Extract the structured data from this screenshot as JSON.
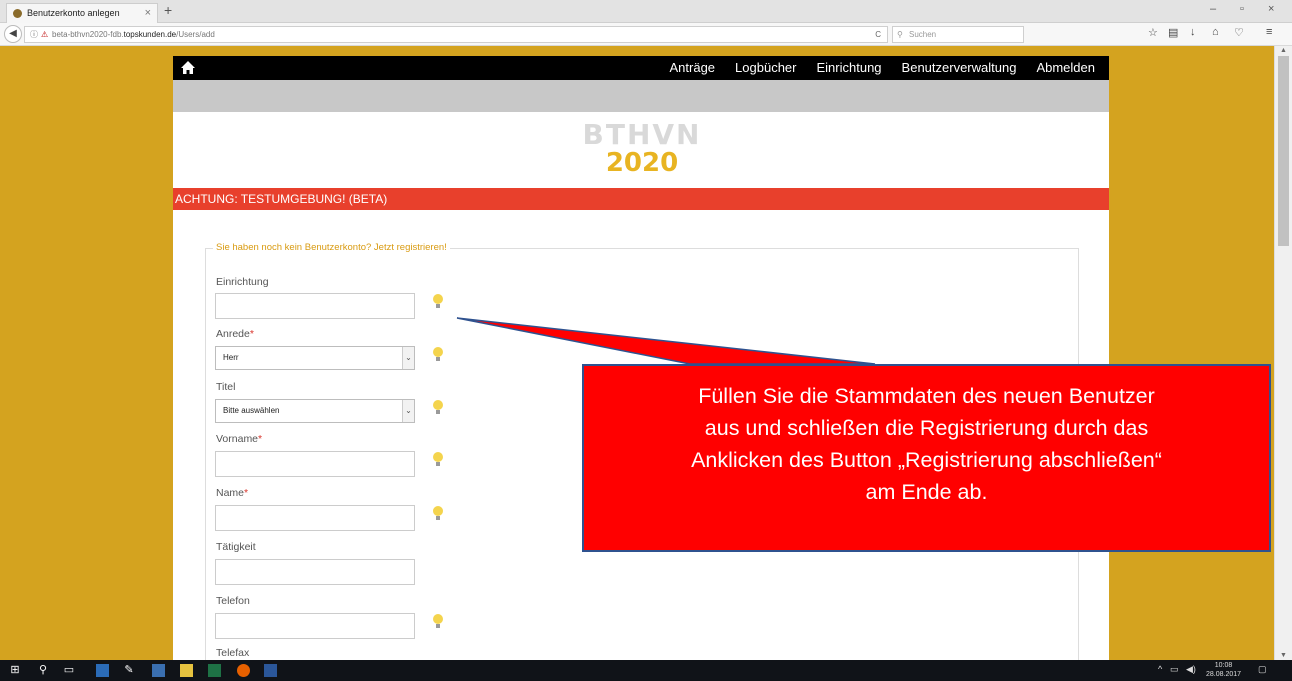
{
  "browser": {
    "tab_title": "Benutzerkonto anlegen",
    "tab_close": "×",
    "new_tab": "+",
    "window_controls": [
      "–",
      "▫",
      "×"
    ],
    "url_prefix": "beta-bthvn2020-fdb.",
    "url_domain": "topskunden.de",
    "url_path": "/Users/add",
    "reload": "C",
    "search_placeholder": "Suchen"
  },
  "site": {
    "nav_links": [
      "Anträge",
      "Logbücher",
      "Einrichtung",
      "Benutzerverwaltung",
      "Abmelden"
    ],
    "logo_line1": "BTHVN",
    "logo_line2": "2020",
    "warning": "ACHTUNG: TESTUMGEBUNG! (BETA)"
  },
  "form": {
    "legend": "Sie haben noch kein Benutzerkonto? Jetzt registrieren!",
    "required_mark": "*",
    "fields": {
      "einrichtung": "Einrichtung",
      "anrede": "Anrede",
      "anrede_value": "Herr",
      "titel": "Titel",
      "titel_value": "Bitte auswählen",
      "vorname": "Vorname",
      "name": "Name",
      "taetigkeit": "Tätigkeit",
      "telefon": "Telefon",
      "telefax": "Telefax"
    }
  },
  "callout": {
    "lines": [
      "Füllen Sie die Stammdaten des neuen Benutzer",
      "aus und schließen die Registrierung durch das",
      "Anklicken des Button „Registrierung abschließen“",
      "am Ende ab."
    ],
    "fill_color": "#ff0000",
    "border_color": "#2f528f"
  },
  "taskbar": {
    "time": "10:08",
    "date": "28.08.2017"
  },
  "colors": {
    "page_background": "#d4a31f",
    "warning_bar": "#e8402c",
    "legend_text": "#d99b12",
    "logo_accent": "#e8b422"
  }
}
